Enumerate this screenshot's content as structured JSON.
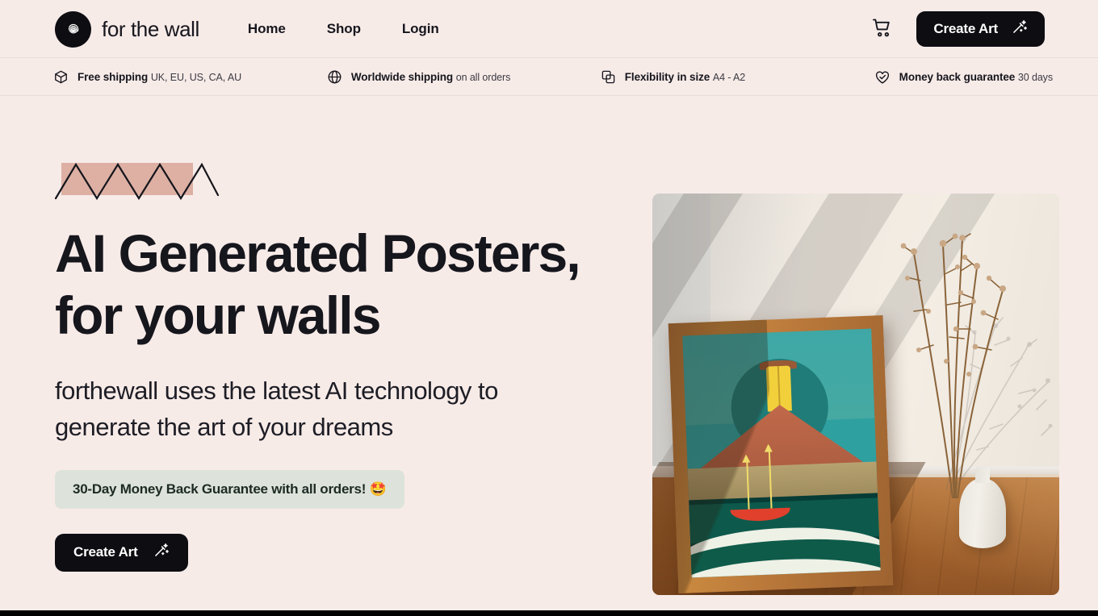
{
  "theme": {
    "background": "#f7ebe8",
    "text_dark": "#16161d",
    "button_dark": "#0d0d12",
    "accent_salmon": "#ddb0a3",
    "badge_green": "#dde3da",
    "bottom_bar": "#000000"
  },
  "header": {
    "brand_name": "for the wall",
    "logo_icon": "scribble-ball-logo",
    "nav": [
      {
        "label": "Home"
      },
      {
        "label": "Shop"
      },
      {
        "label": "Login"
      }
    ],
    "cart_icon": "shopping-cart-icon",
    "cta": {
      "label": "Create Art",
      "icon": "magic-wand-icon"
    }
  },
  "feature_bar": [
    {
      "icon": "package-box-icon",
      "title": "Free shipping",
      "detail": "UK, EU, US, CA, AU"
    },
    {
      "icon": "globe-icon",
      "title": "Worldwide shipping",
      "detail": "on all orders"
    },
    {
      "icon": "layers-copy-icon",
      "title": "Flexibility in size",
      "detail": "A4 - A2"
    },
    {
      "icon": "heart-check-icon",
      "title": "Money back guarantee",
      "detail": "30 days"
    }
  ],
  "hero": {
    "decoration_icon": "zigzag-accent",
    "title": "AI Generated Posters, for your walls",
    "subtitle": "forthewall uses the latest AI technology to generate the art of your dreams",
    "guarantee_badge": "30-Day Money Back Guarantee with all orders! 🤩",
    "cta": {
      "label": "Create Art",
      "icon": "magic-wand-icon"
    },
    "image_alt": "framed AI generated sailboat poster leaning on a wall beside a vase of dried branches"
  }
}
